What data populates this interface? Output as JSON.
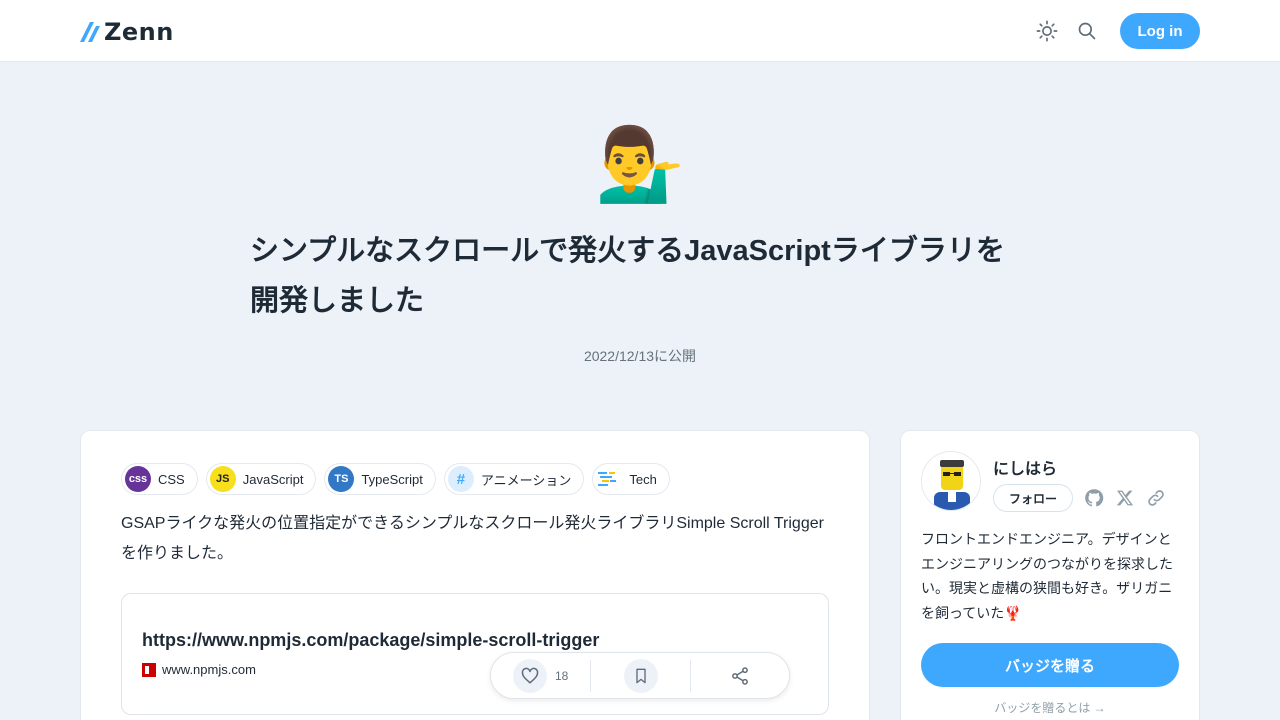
{
  "header": {
    "logo_text": "Zenn",
    "login_label": "Log in",
    "icons": [
      "sun-icon",
      "search-icon"
    ]
  },
  "article": {
    "emoji": "💁‍♂️",
    "title": "シンプルなスクロールで発火するJavaScriptライブラリを開発しました",
    "published": "2022/12/13に公開",
    "topics": [
      {
        "label": "CSS",
        "icon_text": "css",
        "color": "#663399"
      },
      {
        "label": "JavaScript",
        "icon_text": "JS",
        "color": "#f7df1e"
      },
      {
        "label": "TypeScript",
        "icon_text": "TS",
        "color": "#3178c6"
      },
      {
        "label": "アニメーション",
        "icon_text": "#",
        "color": "#dceefe"
      },
      {
        "label": "Tech",
        "icon_text": "",
        "color": "#ffffff"
      }
    ],
    "intro": "GSAPライクな発火の位置指定ができるシンプルなスクロール発火ライブラリSimple Scroll Triggerを作りました。",
    "link_card": {
      "url": "https://www.npmjs.com/package/simple-scroll-trigger",
      "site": "www.npmjs.com"
    },
    "like_count": "18"
  },
  "sidebar": {
    "author": "にしはら",
    "follow_label": "フォロー",
    "bio": "フロントエンドエンジニア。デザインとエンジニアリングのつながりを探求したい。現実と虚構の狭間も好き。ザリガニを飼っていた🦞",
    "badge_button": "バッジを贈る",
    "badge_link": "バッジを贈るとは →"
  },
  "colors": {
    "accent": "#3ea8ff",
    "background": "#edf2f9"
  }
}
